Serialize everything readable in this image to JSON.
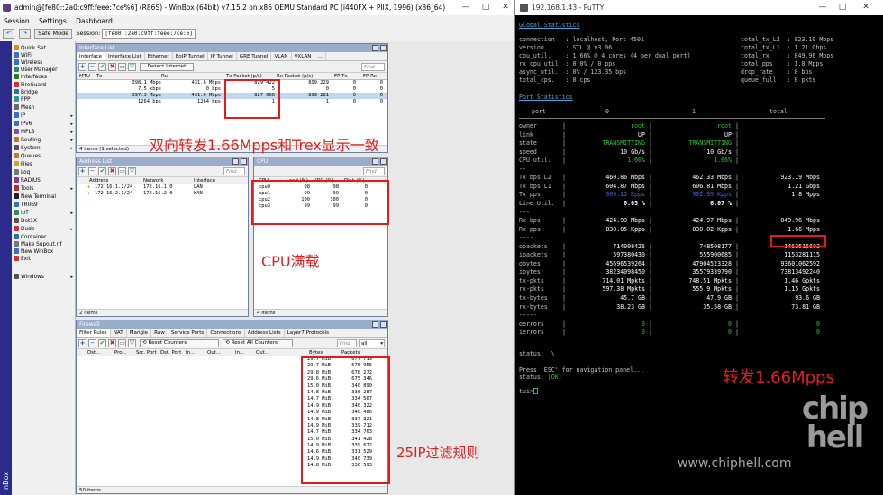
{
  "winbox": {
    "title": "admin@[fe80::2a0:c9ff:feee:7ce%6] (R86S) - WinBox (64bit) v7.15.2 on x86 QEMU Standard PC (i440FX + PIIX, 1996) (x86_64)",
    "menu": [
      "Session",
      "Settings",
      "Dashboard"
    ],
    "toolbar": {
      "safe_mode": "Safe Mode",
      "session_label": "Session:",
      "session_value": "[fe80::2a0:c9ff:feee:7ce:6]"
    },
    "sidebar_vertical_text": "nBox",
    "sidebar": [
      {
        "label": "Quick Set",
        "icon": "quickset-icon",
        "color": "#d98a1e",
        "arrow": ""
      },
      {
        "label": "WiFi",
        "icon": "wifi-icon",
        "color": "#3a6fd0",
        "arrow": ""
      },
      {
        "label": "Wireless",
        "icon": "wireless-icon",
        "color": "#3a6fd0",
        "arrow": ""
      },
      {
        "label": "User Manager",
        "icon": "user-manager-icon",
        "color": "#2e8b57",
        "arrow": ""
      },
      {
        "label": "Interfaces",
        "icon": "interfaces-icon",
        "color": "#2f7a2f",
        "arrow": ""
      },
      {
        "label": "FireGuard",
        "icon": "fireguard-icon",
        "color": "#cc3333",
        "arrow": ""
      },
      {
        "label": "Bridge",
        "icon": "bridge-icon",
        "color": "#2f6db5",
        "arrow": ""
      },
      {
        "label": "PPP",
        "icon": "ppp-icon",
        "color": "#2a9d8f",
        "arrow": ""
      },
      {
        "label": "Mesh",
        "icon": "mesh-icon",
        "color": "#6b6b6b",
        "arrow": ""
      },
      {
        "label": "IP",
        "icon": "ip-icon",
        "color": "#3a6fd0",
        "arrow": "▸"
      },
      {
        "label": "IPv6",
        "icon": "ipv6-icon",
        "color": "#3a6fd0",
        "arrow": "▸"
      },
      {
        "label": "MPLS",
        "icon": "mpls-icon",
        "color": "#7a4fb0",
        "arrow": "▸"
      },
      {
        "label": "Routing",
        "icon": "routing-icon",
        "color": "#b57a2f",
        "arrow": "▸"
      },
      {
        "label": "System",
        "icon": "system-icon",
        "color": "#555555",
        "arrow": "▸"
      },
      {
        "label": "Queues",
        "icon": "queues-icon",
        "color": "#cc7722",
        "arrow": ""
      },
      {
        "label": "Files",
        "icon": "files-icon",
        "color": "#d9a21e",
        "arrow": ""
      },
      {
        "label": "Log",
        "icon": "log-icon",
        "color": "#777777",
        "arrow": ""
      },
      {
        "label": "RADIUS",
        "icon": "radius-icon",
        "color": "#8b3a8b",
        "arrow": ""
      },
      {
        "label": "Tools",
        "icon": "tools-icon",
        "color": "#b03030",
        "arrow": "▸"
      },
      {
        "label": "New Terminal",
        "icon": "terminal-icon",
        "color": "#222222",
        "arrow": ""
      },
      {
        "label": "TR069",
        "icon": "tr069-icon",
        "color": "#3a6fd0",
        "arrow": ""
      },
      {
        "label": "IoT",
        "icon": "iot-icon",
        "color": "#2e8b57",
        "arrow": "▸"
      },
      {
        "label": "Dot1X",
        "icon": "dot1x-icon",
        "color": "#555555",
        "arrow": ""
      },
      {
        "label": "Dude",
        "icon": "dude-icon",
        "color": "#cc3333",
        "arrow": "▸"
      },
      {
        "label": "Container",
        "icon": "container-icon",
        "color": "#2f6db5",
        "arrow": ""
      },
      {
        "label": "Make Supout.rif",
        "icon": "supout-icon",
        "color": "#777777",
        "arrow": ""
      },
      {
        "label": "New WinBox",
        "icon": "winbox-icon",
        "color": "#3a6fd0",
        "arrow": ""
      },
      {
        "label": "Exit",
        "icon": "exit-icon",
        "color": "#cc3333",
        "arrow": ""
      },
      {
        "label": "Windows",
        "icon": "windows-icon",
        "color": "#555555",
        "arrow": "▸"
      }
    ],
    "interface_list": {
      "title": "Interface List",
      "tabs": [
        "Interface",
        "Interface List",
        "Ethernet",
        "EoIP Tunnel",
        "IP Tunnel",
        "GRE Tunnel",
        "VLAN",
        "VXLAN",
        "..."
      ],
      "detect": "Detect Internet",
      "find": "Find",
      "columns": [
        "MTU",
        "Tx",
        "Rx",
        "Tx Packet (p/s)",
        "Rx Packet (p/s)",
        "FP Tx",
        "FP Rx"
      ],
      "rows": [
        {
          "tx": "398.1 Mbps",
          "rx": "431.6 Mbps",
          "txp": "829 422",
          "rxp": "899 229",
          "fp": "0",
          "sel": false
        },
        {
          "tx": "7.5 kbps",
          "rx": "0 bps",
          "txp": "5",
          "rxp": "0",
          "fp": "0",
          "sel": false
        },
        {
          "tx": "397.3 Mbps",
          "rx": "431.6 Mbps",
          "txp": "827 066",
          "rxp": "899 281",
          "fp": "0",
          "sel": true
        },
        {
          "tx": "1264 bps",
          "rx": "1264 bps",
          "txp": "1",
          "rxp": "1",
          "fp": "0",
          "sel": false
        }
      ],
      "footer": "4 items (1 selected)"
    },
    "address_list": {
      "title": "Address List",
      "find": "Find",
      "columns": [
        "Address",
        "Network",
        "Interface"
      ],
      "rows": [
        {
          "address": "172.16.1.1/24",
          "network": "172.16.1.0",
          "interface": "LAN"
        },
        {
          "address": "172.16.2.1/24",
          "network": "172.16.2.0",
          "interface": "WAN"
        }
      ],
      "footer": "2 items"
    },
    "cpu": {
      "title": "CPU",
      "find": "Find",
      "columns": [
        "CPU",
        "Load (%)",
        "IRQ (%)",
        "Disk (%)"
      ],
      "rows": [
        {
          "cpu": "cpu0",
          "load": "98",
          "irq": "98",
          "disk": "0"
        },
        {
          "cpu": "cpu1",
          "load": "99",
          "irq": "99",
          "disk": "0"
        },
        {
          "cpu": "cpu2",
          "load": "100",
          "irq": "100",
          "disk": "0"
        },
        {
          "cpu": "cpu3",
          "load": "99",
          "irq": "99",
          "disk": "0"
        }
      ],
      "footer": "4 items"
    },
    "firewall": {
      "title": "Firewall",
      "tabs": [
        "Filter Rules",
        "NAT",
        "Mangle",
        "Raw",
        "Service Ports",
        "Connections",
        "Address Lists",
        "Layer7 Protocols"
      ],
      "reset": "Reset Counters",
      "reset_all": "Reset All Counters",
      "find": "Find",
      "filter": "all",
      "columns": [
        "Dst...",
        "Pro...",
        "Src. Port",
        "Dst. Port",
        "In...",
        "Out...",
        "In...",
        "Out...",
        "Bytes",
        "Packets"
      ],
      "rows": [
        {
          "bytes": "29.7 MiB",
          "packets": "677 719"
        },
        {
          "bytes": "29.7 MiB",
          "packets": "675 955"
        },
        {
          "bytes": "29.8 MiB",
          "packets": "678 272"
        },
        {
          "bytes": "29.6 MiB",
          "packets": "675 346"
        },
        {
          "bytes": "15.0 MiB",
          "packets": "340 890"
        },
        {
          "bytes": "14.8 MiB",
          "packets": "336 287"
        },
        {
          "bytes": "14.7 MiB",
          "packets": "334 567"
        },
        {
          "bytes": "14.9 MiB",
          "packets": "340 322"
        },
        {
          "bytes": "14.9 MiB",
          "packets": "340 486"
        },
        {
          "bytes": "14.8 MiB",
          "packets": "337 321"
        },
        {
          "bytes": "14.9 MiB",
          "packets": "339 712"
        },
        {
          "bytes": "14.7 MiB",
          "packets": "334 763"
        },
        {
          "bytes": "15.0 MiB",
          "packets": "341 428"
        },
        {
          "bytes": "14.9 MiB",
          "packets": "339 672"
        },
        {
          "bytes": "14.6 MiB",
          "packets": "331 529"
        },
        {
          "bytes": "14.9 MiB",
          "packets": "340 739"
        },
        {
          "bytes": "14.8 MiB",
          "packets": "336 593"
        }
      ],
      "footer": "50 items"
    },
    "annotations": {
      "bidirectional": "双向转发1.66Mpps和Trex显示一致",
      "cpu_full": "CPU满载",
      "filter_rules": "25IP过滤规则"
    }
  },
  "putty": {
    "title": "192.168.1.43 - PuTTY",
    "global_header": "Global Statistics",
    "global_lines": [
      [
        "connection   : localhost, Port 4501",
        "total_tx_L2  : 923.19 Mbps"
      ],
      [
        "version      : STL @ v3.06",
        "total_tx_L1  : 1.21 Gbps"
      ],
      [
        "cpu_util.    : 1.66% @ 4 cores (4 per dual port)",
        "total_rx     : 849.96 Mbps"
      ],
      [
        "rx_cpu_util. : 0.0% / 0 pps",
        "total_pps    : 1.8 Mpps"
      ],
      [
        "async_util.  : 0% / 123.35 bps",
        "drop_rate    : 0 bps"
      ],
      [
        "total_cps.   : 0 cps",
        "queue_full   : 0 pkts"
      ]
    ],
    "port_header": "Port Statistics",
    "port_columns": [
      "port",
      "0",
      "1",
      "total"
    ],
    "port_rows": [
      {
        "name": "owner",
        "p0": "root",
        "p1": "root",
        "t": ""
      },
      {
        "name": "link",
        "p0": "UP",
        "p1": "UP",
        "t": ""
      },
      {
        "name": "state",
        "p0": "TRANSMITTING",
        "p1": "TRANSMITTING",
        "t": ""
      },
      {
        "name": "speed",
        "p0": "10 Gb/s",
        "p1": "10 Gb/s",
        "t": ""
      },
      {
        "name": "CPU util.",
        "p0": "1.66%",
        "p1": "1.66%",
        "t": ""
      },
      {
        "name": "--",
        "p0": "",
        "p1": "",
        "t": ""
      },
      {
        "name": "Tx bps L2",
        "p0": "460.86 Mbps",
        "p1": "462.33 Mbps",
        "t": "923.19 Mbps"
      },
      {
        "name": "Tx bps L1",
        "p0": "604.87 Mbps",
        "p1": "606.81 Mbps",
        "t": "1.21 Gbps"
      },
      {
        "name": "Tx pps",
        "p0": "900.11 Kpps",
        "p1": "902.99 Kpps",
        "t": "1.8 Mpps"
      },
      {
        "name": "Line Util.",
        "p0": "6.05 %",
        "p1": "6.07 %",
        "t": ""
      },
      {
        "name": "---",
        "p0": "",
        "p1": "",
        "t": ""
      },
      {
        "name": "Rx bps",
        "p0": "424.99 Mbps",
        "p1": "424.97 Mbps",
        "t": "849.96 Mbps"
      },
      {
        "name": "Rx pps",
        "p0": "830.05 Kpps",
        "p1": "830.02 Kpps",
        "t": "1.66 Mpps"
      },
      {
        "name": "----",
        "p0": "",
        "p1": "",
        "t": ""
      },
      {
        "name": "opackets",
        "p0": "714008426",
        "p1": "748508177",
        "t": "1462516603"
      },
      {
        "name": "ipackets",
        "p0": "597380430",
        "p1": "555900685",
        "t": "1153281115"
      },
      {
        "name": "obytes",
        "p0": "45696539264",
        "p1": "47904523328",
        "t": "93601062592"
      },
      {
        "name": "ibytes",
        "p0": "38234098450",
        "p1": "35579339790",
        "t": "73813492240"
      },
      {
        "name": "tx-pkts",
        "p0": "714.01 Mpkts",
        "p1": "748.51 Mpkts",
        "t": "1.46 Gpkts"
      },
      {
        "name": "rx-pkts",
        "p0": "597.38 Mpkts",
        "p1": "555.9 Mpkts",
        "t": "1.15 Gpkts"
      },
      {
        "name": "tx-bytes",
        "p0": "45.7 GB",
        "p1": "47.9 GB",
        "t": "93.6 GB"
      },
      {
        "name": "rx-bytes",
        "p0": "38.23 GB",
        "p1": "35.58 GB",
        "t": "73.81 GB"
      },
      {
        "name": "-----",
        "p0": "",
        "p1": "",
        "t": ""
      },
      {
        "name": "oerrors",
        "p0": "0",
        "p1": "0",
        "t": "0"
      },
      {
        "name": "ierrors",
        "p0": "0",
        "p1": "0",
        "t": "0"
      }
    ],
    "status": "status:  \\",
    "press_esc": "Press 'ESC' for navigation panel...",
    "status_ok_prefix": "status: ",
    "status_ok": "[OK]",
    "prompt": "tui>",
    "annotation": "转发1.66Mpps",
    "watermark_url": "www.chiphell.com",
    "watermark_logo": "chip hell"
  }
}
